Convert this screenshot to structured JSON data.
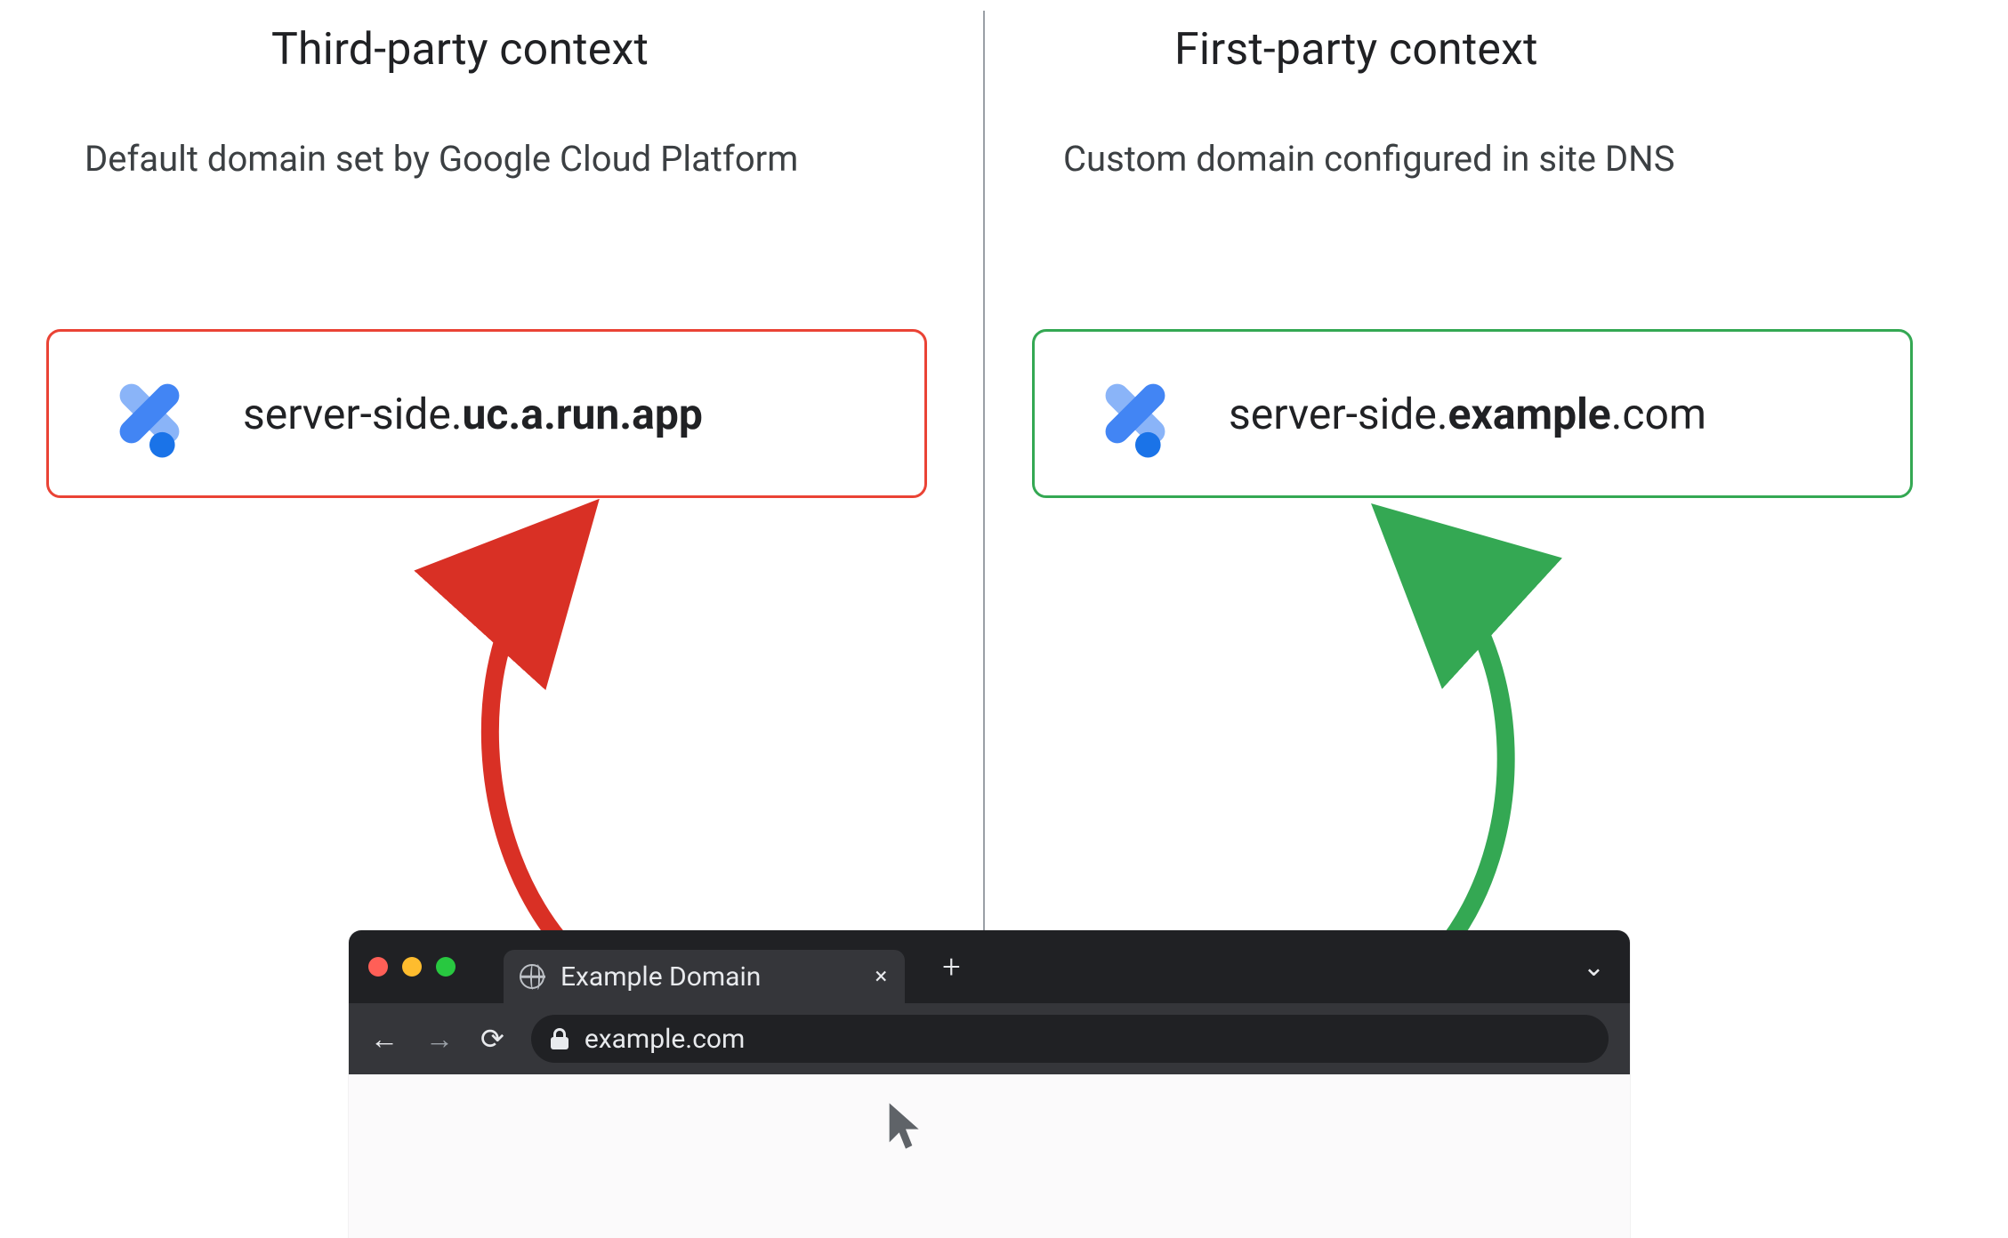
{
  "left": {
    "title": "Third-party context",
    "subtitle": "Default domain set by Google Cloud Platform",
    "server": {
      "prefix": "server-side.",
      "bold": "uc.a.run.app",
      "suffix": ""
    },
    "box_color": "#ea4335",
    "arrow_color": "#d93025"
  },
  "right": {
    "title": "First-party context",
    "subtitle": "Custom domain configured in site DNS",
    "server": {
      "prefix": "server-side.",
      "bold": "example",
      "suffix": ".com"
    },
    "box_color": "#34a853",
    "arrow_color": "#34a853"
  },
  "gtm_icon_name": "google-tag-manager-icon",
  "browser": {
    "tab_title": "Example Domain",
    "address": "example.com",
    "close_glyph": "×",
    "plus_glyph": "+",
    "caret_glyph": "⌄",
    "back_glyph": "←",
    "forward_glyph": "→",
    "reload_glyph": "⟳"
  }
}
